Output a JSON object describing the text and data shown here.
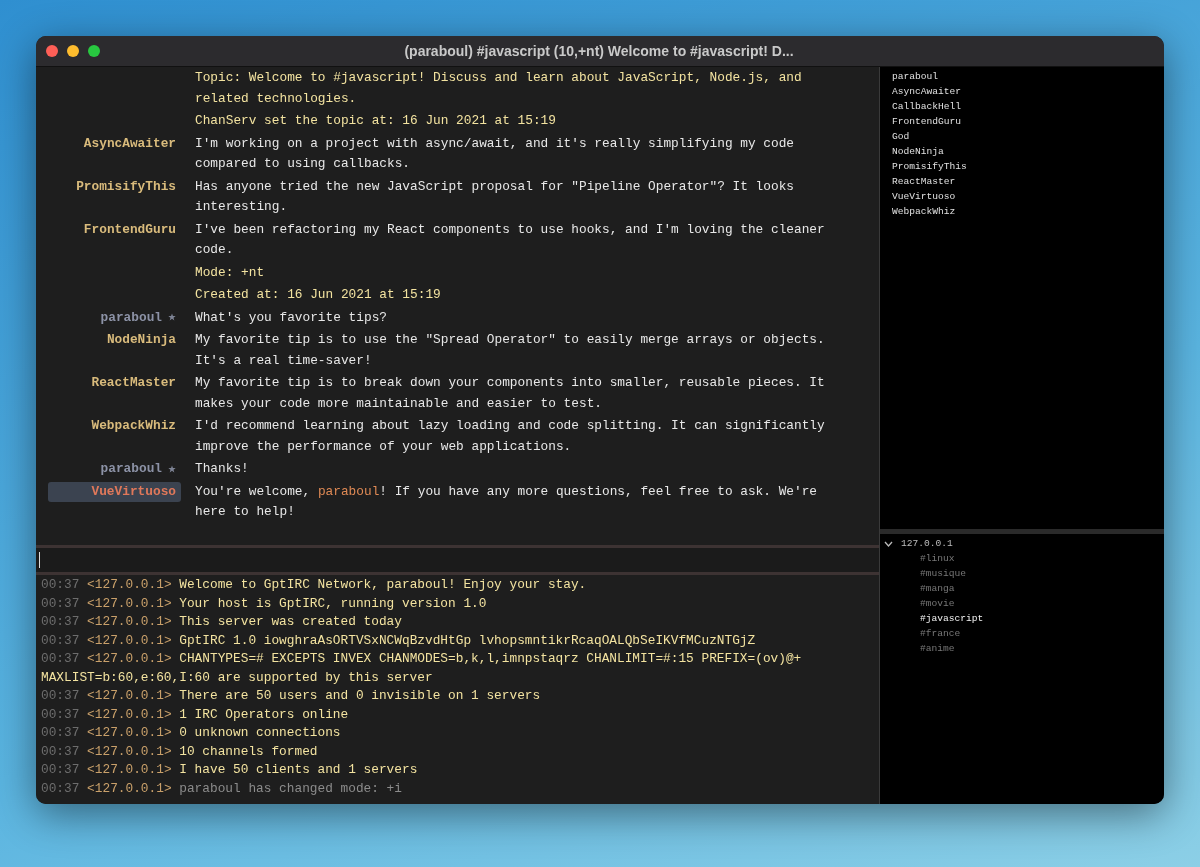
{
  "window": {
    "title": "(paraboul) #javascript (10,+nt) Welcome to #javascript! D..."
  },
  "chat": [
    {
      "kind": "system",
      "parts": [
        {
          "text": "Topic: Welcome to #javascript! Discuss and learn about JavaScript, Node.js, and related technologies."
        }
      ]
    },
    {
      "kind": "system",
      "parts": [
        {
          "text": "ChanServ set the topic at: 16 Jun 2021 at 15:19"
        }
      ]
    },
    {
      "kind": "message",
      "nick": "AsyncAwaiter",
      "self": false,
      "selected": false,
      "parts": [
        {
          "text": "I'm working on a project with async/await, and it's really simplifying my code compared to using callbacks."
        }
      ]
    },
    {
      "kind": "message",
      "nick": "PromisifyThis",
      "self": false,
      "selected": false,
      "parts": [
        {
          "text": "Has anyone tried the new JavaScript proposal for \"Pipeline Operator\"? It looks interesting."
        }
      ]
    },
    {
      "kind": "message",
      "nick": "FrontendGuru",
      "self": false,
      "selected": false,
      "parts": [
        {
          "text": "I've been refactoring my React components to use hooks, and I'm loving the cleaner code."
        }
      ]
    },
    {
      "kind": "system",
      "parts": [
        {
          "text": "Mode: +nt"
        }
      ]
    },
    {
      "kind": "system",
      "parts": [
        {
          "text": "Created at: 16 Jun 2021 at 15:19"
        }
      ]
    },
    {
      "kind": "message",
      "nick": "paraboul",
      "self": true,
      "selected": false,
      "parts": [
        {
          "text": "What's you favorite tips?"
        }
      ]
    },
    {
      "kind": "message",
      "nick": "NodeNinja",
      "self": false,
      "selected": false,
      "parts": [
        {
          "text": "My favorite tip is to use the \"Spread Operator\" to easily merge arrays or objects. It's a real time-saver!"
        }
      ]
    },
    {
      "kind": "message",
      "nick": "ReactMaster",
      "self": false,
      "selected": false,
      "parts": [
        {
          "text": "My favorite tip is to break down your components into smaller, reusable pieces. It makes your code more maintainable and easier to test."
        }
      ]
    },
    {
      "kind": "message",
      "nick": "WebpackWhiz",
      "self": false,
      "selected": false,
      "parts": [
        {
          "text": "I'd recommend learning about lazy loading and code splitting. It can significantly improve the performance of your web applications."
        }
      ]
    },
    {
      "kind": "message",
      "nick": "paraboul",
      "self": true,
      "selected": false,
      "parts": [
        {
          "text": "Thanks!"
        }
      ]
    },
    {
      "kind": "message",
      "nick": "VueVirtuoso",
      "self": false,
      "selected": true,
      "parts": [
        {
          "text": "You're welcome, "
        },
        {
          "text": "paraboul",
          "kind": "mention"
        },
        {
          "text": "! If you have any more questions, feel free to ask. We're here to help!"
        }
      ]
    }
  ],
  "log": [
    {
      "time": "00:37",
      "source": "<127.0.0.1>",
      "text": "Welcome to GptIRC Network, paraboul! Enjoy your stay.",
      "dim": false
    },
    {
      "time": "00:37",
      "source": "<127.0.0.1>",
      "text": "Your host is GptIRC, running version 1.0",
      "dim": false
    },
    {
      "time": "00:37",
      "source": "<127.0.0.1>",
      "text": "This server was created today",
      "dim": false
    },
    {
      "time": "00:37",
      "source": "<127.0.0.1>",
      "text": "GptIRC 1.0 iowghraAsORTVSxNCWqBzvdHtGp lvhopsmntikrRcaqOALQbSeIKVfMCuzNTGjZ",
      "dim": false
    },
    {
      "time": "00:37",
      "source": "<127.0.0.1>",
      "text": "CHANTYPES=# EXCEPTS INVEX CHANMODES=b,k,l,imnpstaqrz CHANLIMIT=#:15 PREFIX=(ov)@+ MAXLIST=b:60,e:60,I:60 are supported by this server",
      "dim": false
    },
    {
      "time": "00:37",
      "source": "<127.0.0.1>",
      "text": "There are 50 users and 0 invisible on 1 servers",
      "dim": false
    },
    {
      "time": "00:37",
      "source": "<127.0.0.1>",
      "text": "1 IRC Operators online",
      "dim": false
    },
    {
      "time": "00:37",
      "source": "<127.0.0.1>",
      "text": "0 unknown connections",
      "dim": false
    },
    {
      "time": "00:37",
      "source": "<127.0.0.1>",
      "text": "10 channels formed",
      "dim": false
    },
    {
      "time": "00:37",
      "source": "<127.0.0.1>",
      "text": "I have 50 clients and 1 servers",
      "dim": false
    },
    {
      "time": "00:37",
      "source": "<127.0.0.1>",
      "text": "paraboul has changed mode: +i",
      "dim": true
    }
  ],
  "nicklist": [
    "paraboul",
    "AsyncAwaiter",
    "CallbackHell",
    "FrontendGuru",
    "God",
    "NodeNinja",
    "PromisifyThis",
    "ReactMaster",
    "VueVirtuoso",
    "WebpackWhiz"
  ],
  "servers": [
    {
      "label": "127.0.0.1",
      "expanded": true,
      "children": [
        {
          "label": "#linux",
          "selected": false
        },
        {
          "label": "#musique",
          "selected": false
        },
        {
          "label": "#manga",
          "selected": false
        },
        {
          "label": "#movie",
          "selected": false
        },
        {
          "label": "#javascript",
          "selected": true
        },
        {
          "label": "#france",
          "selected": false
        },
        {
          "label": "#anime",
          "selected": false
        }
      ]
    }
  ]
}
